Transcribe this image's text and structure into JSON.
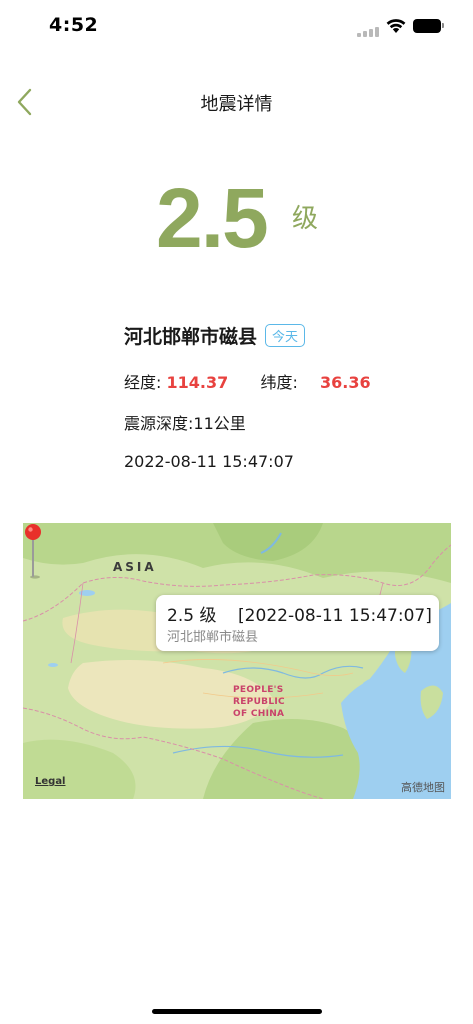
{
  "status_bar": {
    "time": "4:52"
  },
  "nav": {
    "title": "地震详情"
  },
  "magnitude": {
    "value": "2.5",
    "unit": "级"
  },
  "info": {
    "location": "河北邯郸市磁县",
    "badge": "今天",
    "longitude_label": "经度:",
    "longitude_value": "114.37",
    "latitude_label": "纬度:",
    "latitude_value": "36.36",
    "depth": "震源深度:11公里",
    "time": "2022-08-11 15:47:07"
  },
  "map": {
    "label_asia": "ASIA",
    "label_china": "PEOPLE'S\nREPUBLIC\nOF CHINA",
    "legal": "Legal",
    "watermark": "高德地图",
    "callout_title": "2.5 级    [2022-08-11 15:47:07]",
    "callout_subtitle": "河北邯郸市磁县"
  },
  "colors": {
    "accent_green": "#8fa85e",
    "coordinate_red": "#e8423f",
    "badge_blue": "#5bb8e8",
    "pin_red": "#e8302a"
  }
}
